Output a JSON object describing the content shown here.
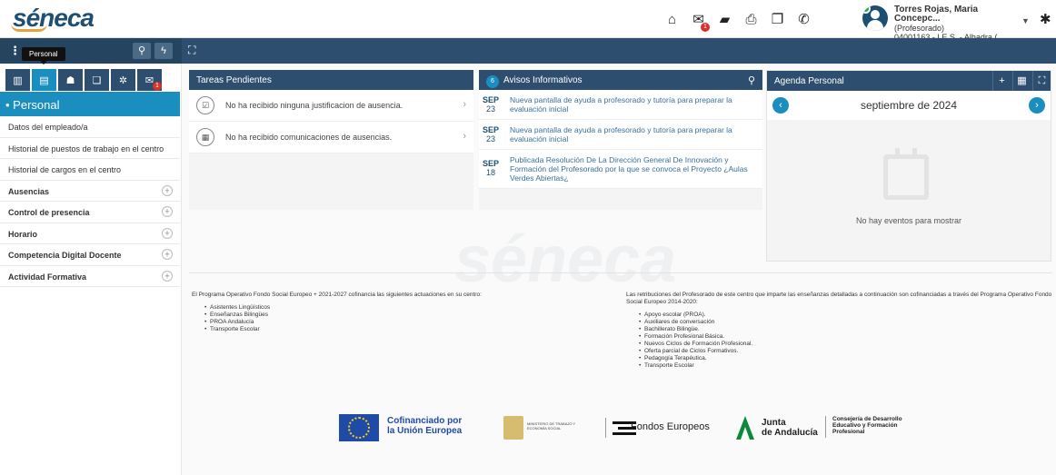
{
  "header": {
    "logo_text": "séneca",
    "user_name": "Torres Rojas, Maria Concepc...",
    "user_role": "(Profesorado)",
    "user_center": "04001163 - I.E.S. - Alhadra (...",
    "mail_badge": "1",
    "icons": [
      "home-icon",
      "mail-icon",
      "folder-icon",
      "print-icon",
      "copy-icon",
      "phone-icon"
    ]
  },
  "toolbar": {
    "tooltip": "Personal"
  },
  "sidebar": {
    "tab_badge": "1",
    "section_title": "Personal",
    "items": [
      {
        "label": "Datos del empleado/a",
        "group": false
      },
      {
        "label": "Historial de puestos de trabajo en el centro",
        "group": false
      },
      {
        "label": "Historial de cargos en el centro",
        "group": false
      },
      {
        "label": "Ausencias",
        "group": true
      },
      {
        "label": "Control de presencia",
        "group": true
      },
      {
        "label": "Horario",
        "group": true
      },
      {
        "label": "Competencia Digital Docente",
        "group": true
      },
      {
        "label": "Actividad Formativa",
        "group": true
      }
    ]
  },
  "tasks": {
    "title": "Tareas Pendientes",
    "items": [
      {
        "text": "No ha recibido ninguna justificacion de ausencia."
      },
      {
        "text": "No ha recibido comunicaciones de ausencias."
      }
    ]
  },
  "avisos": {
    "title": "Avisos Informativos",
    "count": "6",
    "items": [
      {
        "month": "SEP",
        "day": "23",
        "text": "Nueva pantalla de ayuda a profesorado y tutoría para preparar la evaluación inicial"
      },
      {
        "month": "SEP",
        "day": "23",
        "text": "Nueva pantalla de ayuda a profesorado y tutoría para preparar la evaluación inicial"
      },
      {
        "month": "SEP",
        "day": "18",
        "text": "Publicada Resolución De La Dirección General De Innovación y Formación del Profesorado por la que se convoca el Proyecto ¿Aulas Verdes Abiertas¿"
      }
    ]
  },
  "agenda": {
    "title": "Agenda Personal",
    "month": "septiembre de 2024",
    "empty": "No hay eventos para mostrar"
  },
  "footer": {
    "left_intro": "El Programa Operativo Fondo Social Europeo + 2021-2027 cofinancia las siguientes actuaciones en su centro:",
    "left_items": [
      "Asistentes Lingüísticos",
      "Enseñanzas Bilingües",
      "PROA Andalucía",
      "Transporte Escolar"
    ],
    "right_intro": "Las retribuciones del Profesorado de este centro que imparte las enseñanzas detalladas a continuación son cofinanciadas a través del Programa Operativo Fondo Social Europeo 2014-2020:",
    "right_items": [
      "Apoyo escolar (PROA).",
      "Auxiliares de conversación",
      "Bachillerato Bilingüe.",
      "Formación Profesional Básica.",
      "Nuevos Ciclos de Formación Profesional.",
      "Oferta parcial de Ciclos Formativos.",
      "Pedagogía Terapéutica.",
      "Transporte Escolar"
    ],
    "eu_line1": "Cofinanciado por",
    "eu_line2": "la Unión Europea",
    "ministerio": "MINISTERIO DE TRABAJO Y ECONOMÍA SOCIAL",
    "fondos": "Fondos Europeos",
    "junta_line1": "Junta",
    "junta_line2": "de Andalucía",
    "consejeria": "Consejería de Desarrollo Educativo y Formación Profesional"
  }
}
